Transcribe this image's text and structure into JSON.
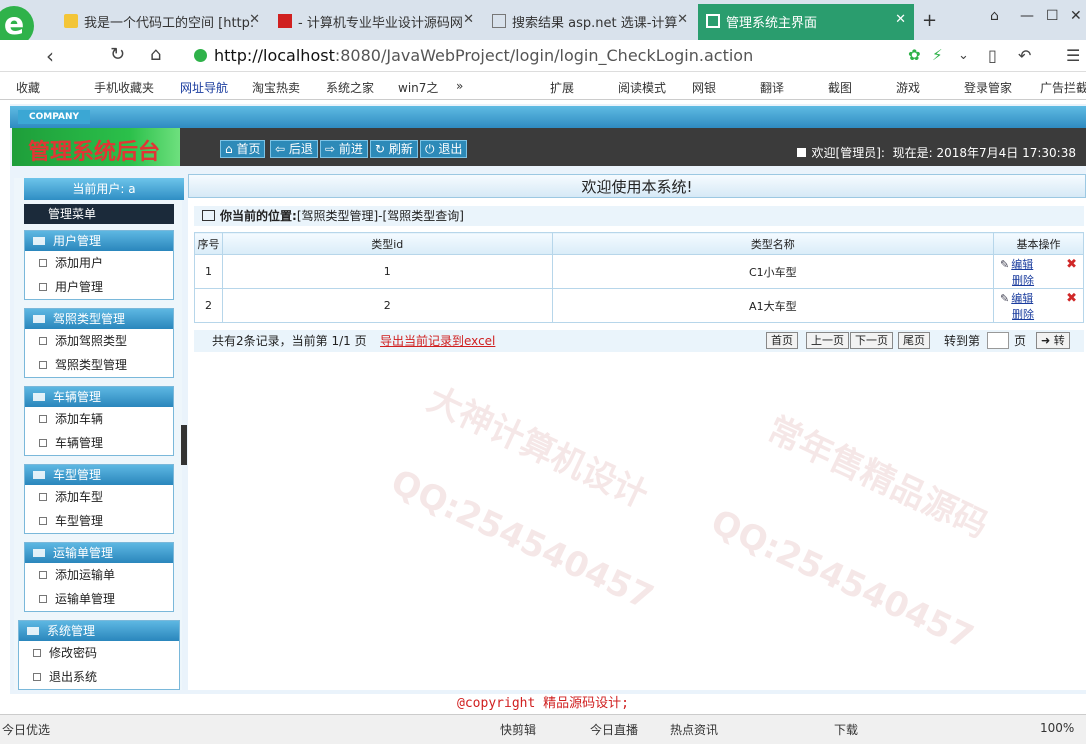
{
  "browser": {
    "tabs": [
      {
        "label": "我是一个代码工的空间 [http:",
        "active": false
      },
      {
        "label": "- 计算机专业毕业设计源码网",
        "active": false
      },
      {
        "label": "搜索结果 asp.net 选课-计算",
        "active": false
      },
      {
        "label": "管理系统主界面",
        "active": true
      }
    ],
    "new_tab": "+",
    "url_host": "http://localhost",
    "url_rest": ":8080/JavaWebProject/login/login_CheckLogin.action",
    "bookmarks": [
      "收藏",
      "手机收藏夹",
      "网址导航",
      "淘宝热卖",
      "系统之家",
      "win7之",
      "»",
      "扩展",
      "阅读模式",
      "网银",
      "翻译",
      "截图",
      "游戏",
      "登录管家",
      "广告拦截"
    ]
  },
  "app": {
    "company": "COMPANY",
    "brand": "管理系统后台",
    "nav_buttons": [
      "首页",
      "后退",
      "前进",
      "刷新",
      "退出"
    ],
    "welcome_user": "欢迎[管理员]:",
    "now_label": "现在是:",
    "now_value": "2018年7月4日 17:30:38",
    "current_user": "当前用户: a",
    "menu_title": "管理菜单",
    "welcome_banner": "欢迎使用本系统!",
    "position_label": "你当前的位置:",
    "position_value": "[驾照类型管理]-[驾照类型查询]",
    "menu_groups": [
      {
        "title": "用户管理",
        "items": [
          "添加用户",
          "用户管理"
        ]
      },
      {
        "title": "驾照类型管理",
        "items": [
          "添加驾照类型",
          "驾照类型管理"
        ]
      },
      {
        "title": "车辆管理",
        "items": [
          "添加车辆",
          "车辆管理"
        ]
      },
      {
        "title": "车型管理",
        "items": [
          "添加车型",
          "车型管理"
        ]
      },
      {
        "title": "运输单管理",
        "items": [
          "添加运输单",
          "运输单管理"
        ]
      },
      {
        "title": "系统管理",
        "items": [
          "修改密码",
          "退出系统"
        ]
      }
    ],
    "table": {
      "headers": [
        "序号",
        "类型id",
        "类型名称",
        "基本操作"
      ],
      "rows": [
        {
          "no": "1",
          "id": "1",
          "name": "C1小车型",
          "edit": "编辑",
          "del": "删除"
        },
        {
          "no": "2",
          "id": "2",
          "name": "A1大车型",
          "edit": "编辑",
          "del": "删除"
        }
      ]
    },
    "pager": {
      "count": "共有2条记录，当前第 1/1 页",
      "export": "导出当前记录到excel",
      "buttons": [
        "首页",
        "上一页",
        "下一页",
        "尾页"
      ],
      "goto_label": "转到第",
      "page_unit": "页",
      "go": "转"
    },
    "footer": "@copyright 精品源码设计;"
  },
  "status": {
    "left": "今日优选",
    "items": [
      "快剪辑",
      "今日直播",
      "热点资讯",
      "下载",
      "100%"
    ]
  }
}
